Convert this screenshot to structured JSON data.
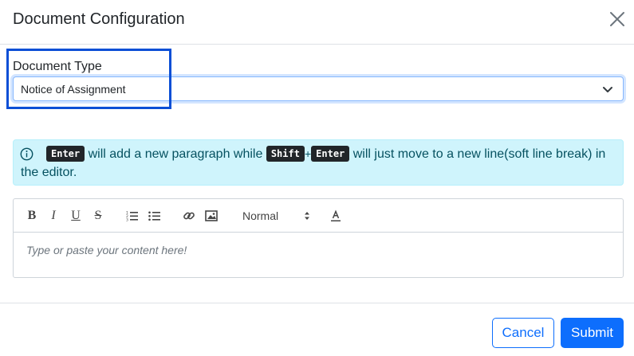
{
  "modal": {
    "title": "Document Configuration",
    "close_icon": "close-icon"
  },
  "document_type": {
    "label": "Document Type",
    "selected": "Notice of Assignment"
  },
  "info_alert": {
    "icon": "info-icon",
    "key_enter": "Enter",
    "text_1": "will add a new paragraph while",
    "key_shift": "Shift",
    "plus": "+",
    "key_enter_2": "Enter",
    "text_2": "will just move to a new line(soft line break) in the editor."
  },
  "editor": {
    "toolbar": {
      "bold": "B",
      "italic": "I",
      "underline": "U",
      "strike": "S",
      "size": "Normal",
      "color_icon": "text-color-icon"
    },
    "placeholder": "Type or paste your content here!"
  },
  "footer": {
    "cancel_label": "Cancel",
    "submit_label": "Submit"
  },
  "colors": {
    "primary": "#0d6efd",
    "highlight": "#0b4fd6",
    "info_bg": "#cff4fc",
    "info_text": "#055160"
  }
}
